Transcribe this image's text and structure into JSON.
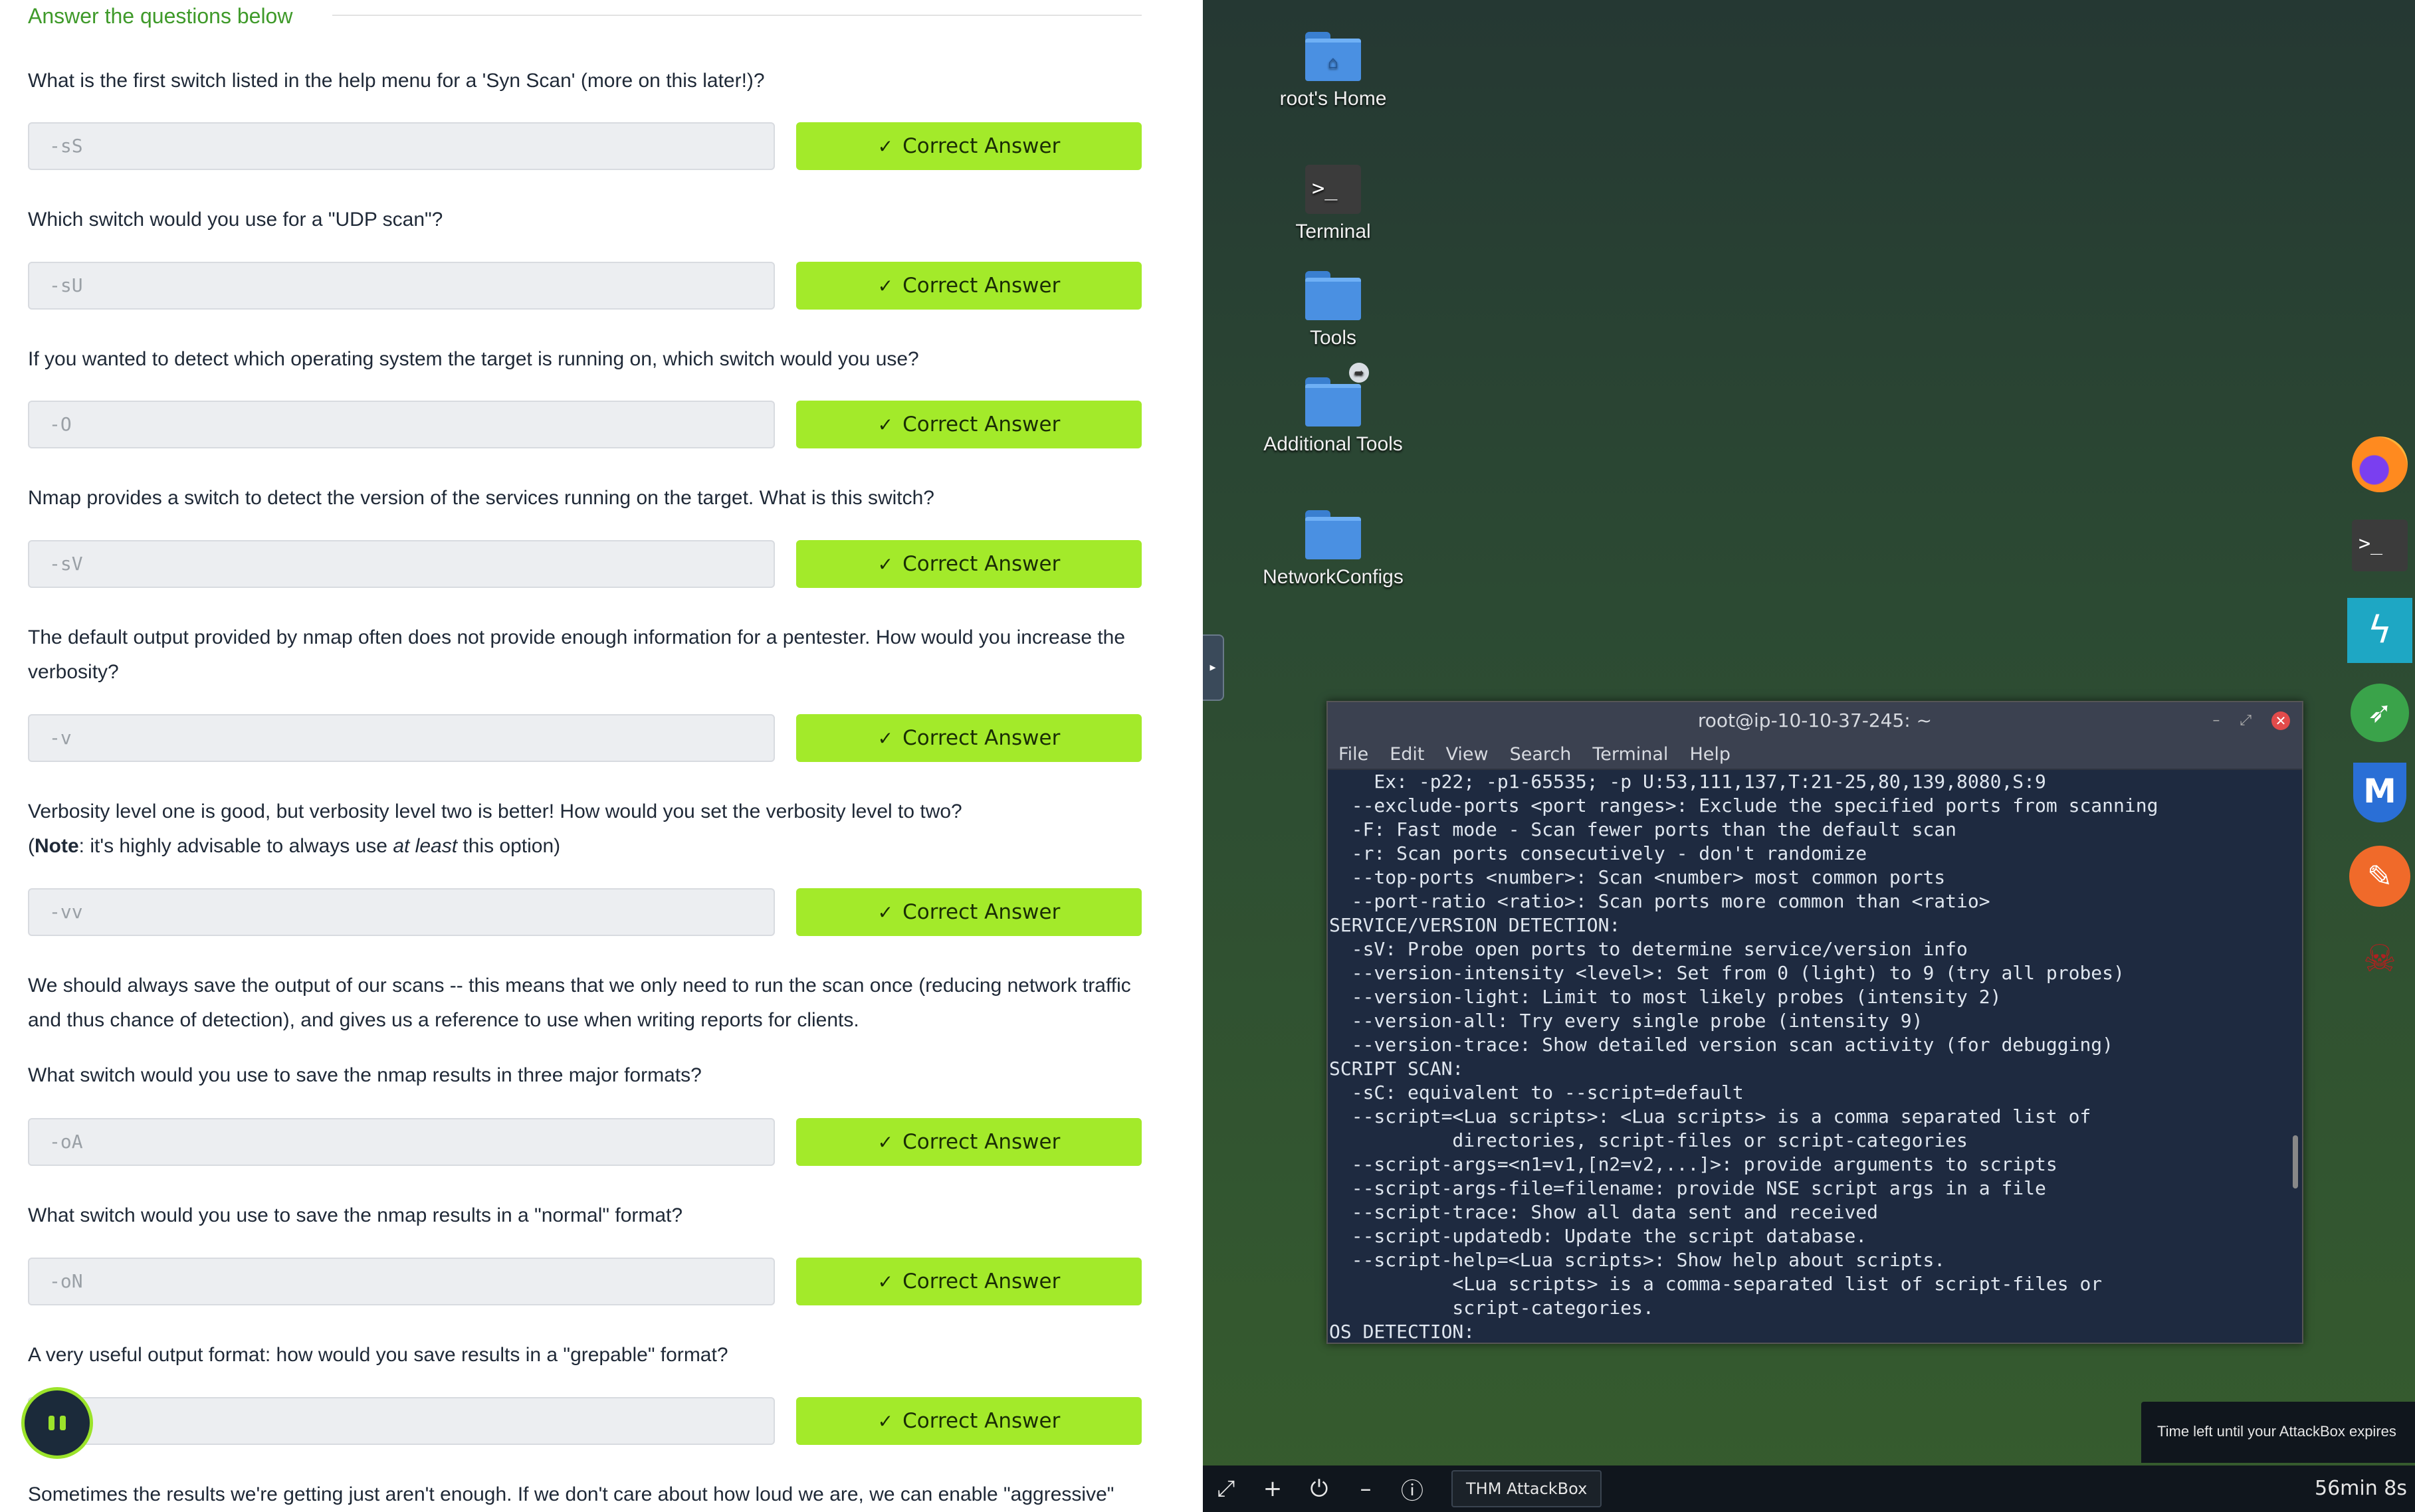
{
  "panel": {
    "section_title": "Answer the questions below",
    "button_label": "Correct Answer",
    "questions": [
      {
        "text": "What is the first switch listed in the help menu for a 'Syn Scan' (more on this later!)?",
        "answer": "-sS"
      },
      {
        "text": "Which switch would you use for a \"UDP scan\"?",
        "answer": "-sU"
      },
      {
        "text": "If you wanted to detect which operating system the target is running on, which switch would you use?",
        "answer": "-O"
      },
      {
        "text": "Nmap provides a switch to detect the version of the services running on the target. What is this switch?",
        "answer": "-sV"
      },
      {
        "text": "The default output provided by nmap often does not provide enough information for a pentester. How would you increase the verbosity?",
        "answer": "-v"
      },
      {
        "text_line1": "Verbosity level one is good, but verbosity level two is better! How would you set the verbosity level to two?",
        "note_bold": "Note",
        "note_a": ": it's highly advisable to always use ",
        "note_em": "at least",
        "note_b": " this option)",
        "answer": "-vv"
      },
      {
        "text": "What switch would you use to save the nmap results in three major formats?",
        "answer": "-oA"
      },
      {
        "text": "What switch would you use to save the nmap results in a \"normal\" format?",
        "answer": "-oN"
      },
      {
        "text": "A very useful output format: how would you save results in a \"grepable\" format?",
        "answer": ""
      }
    ],
    "info_paragraph": "We should always save the output of our scans -- this means that we only need to run the scan once (reducing network traffic and thus chance of detection), and gives us a reference to use when writing reports for clients.",
    "bottom_paragraph": "Sometimes the results we're getting just aren't enough. If we don't care about how loud we are, we can enable \"aggressive\""
  },
  "desktop": {
    "icons": [
      {
        "label": "root's Home",
        "icon": "home-folder-icon"
      },
      {
        "label": "Terminal",
        "icon": "terminal-icon"
      },
      {
        "label": "Tools",
        "icon": "folder-icon"
      },
      {
        "label": "Additional Tools",
        "icon": "linked-folder-icon"
      },
      {
        "label": "NetworkConfigs",
        "icon": "folder-icon"
      }
    ],
    "terminal": {
      "title": "root@ip-10-10-37-245: ~",
      "menu": [
        "File",
        "Edit",
        "View",
        "Search",
        "Terminal",
        "Help"
      ],
      "lines": [
        "    Ex: -p22; -p1-65535; -p U:53,111,137,T:21-25,80,139,8080,S:9",
        "  --exclude-ports <port ranges>: Exclude the specified ports from scanning",
        "  -F: Fast mode - Scan fewer ports than the default scan",
        "  -r: Scan ports consecutively - don't randomize",
        "  --top-ports <number>: Scan <number> most common ports",
        "  --port-ratio <ratio>: Scan ports more common than <ratio>",
        "SERVICE/VERSION DETECTION:",
        "  -sV: Probe open ports to determine service/version info",
        "  --version-intensity <level>: Set from 0 (light) to 9 (try all probes)",
        "  --version-light: Limit to most likely probes (intensity 2)",
        "  --version-all: Try every single probe (intensity 9)",
        "  --version-trace: Show detailed version scan activity (for debugging)",
        "SCRIPT SCAN:",
        "  -sC: equivalent to --script=default",
        "  --script=<Lua scripts>: <Lua scripts> is a comma separated list of",
        "           directories, script-files or script-categories",
        "  --script-args=<n1=v1,[n2=v2,...]>: provide arguments to scripts",
        "  --script-args-file=filename: provide NSE script args in a file",
        "  --script-trace: Show all data sent and received",
        "  --script-updatedb: Update the script database.",
        "  --script-help=<Lua scripts>: Show help about scripts.",
        "           <Lua scripts> is a comma-separated list of script-files or",
        "           script-categories.",
        "OS DETECTION:"
      ]
    },
    "dock": [
      "firefox-icon",
      "terminal-icon",
      "burp-icon",
      "rocket-icon",
      "metasploit-icon",
      "feather-icon",
      "hydra-icon"
    ],
    "tooltip": "Time left until your AttackBox expires",
    "taskbar": {
      "button_label": "THM AttackBox",
      "timer": "56min 8s",
      "icons": [
        "fullscreen-icon",
        "plus-icon",
        "power-icon",
        "minus-icon",
        "info-icon"
      ]
    }
  }
}
